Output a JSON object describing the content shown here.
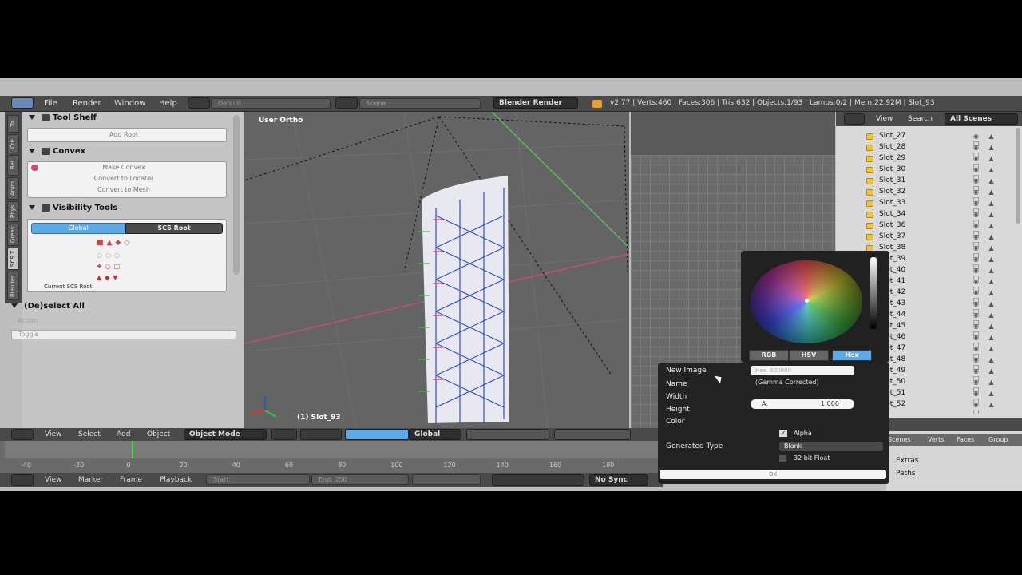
{
  "topbar": {
    "menus": [
      "File",
      "Render",
      "Window",
      "Help"
    ],
    "screen_layout": "Default",
    "scene": "Scene",
    "render_engine": "Blender Render",
    "stats": "v2.77 | Verts:460 | Faces:306 | Tris:632 | Objects:1/93 | Lamps:0/2 | Mem:22.92M | Slot_93"
  },
  "left_tabs": [
    "To",
    "Cre",
    "Rel",
    "Anim",
    "Phys",
    "Greas",
    "SCS T",
    "Blender"
  ],
  "toolshelf": {
    "title": "Tool Shelf",
    "add_root": "Add Root",
    "convex_title": "Convex",
    "convex_buttons": [
      "Make Convex",
      "Convert to Locator",
      "Convert to Mesh"
    ],
    "visibility_title": "Visibility Tools",
    "tab_global": "Global",
    "tab_scs_root": "SCS Root",
    "current_root": "Current SCS Root:",
    "deselect_title": "(De)select All",
    "action_label": "Action",
    "action_value": "Toggle"
  },
  "viewport": {
    "view_name": "User Ortho",
    "object_name": "(1) Slot_93"
  },
  "outliner": {
    "menus": [
      "View",
      "Search"
    ],
    "scope": "All Scenes",
    "items": [
      "Slot_27",
      "Slot_28",
      "Slot_29",
      "Slot_30",
      "Slot_31",
      "Slot_32",
      "Slot_33",
      "Slot_34",
      "Slot_36",
      "Slot_37",
      "Slot_38",
      "Slot_39",
      "Slot_40",
      "Slot_41",
      "Slot_42",
      "Slot_43",
      "Slot_44",
      "Slot_45",
      "Slot_46",
      "Slot_47",
      "Slot_48",
      "Slot_49",
      "Slot_50",
      "Slot_51",
      "Slot_52"
    ]
  },
  "view3d_header": {
    "menus": [
      "View",
      "Select",
      "Add",
      "Object"
    ],
    "mode": "Object Mode",
    "orientation": "Global"
  },
  "timeline": {
    "ticks": [
      "-40",
      "-20",
      "0",
      "20",
      "40",
      "60",
      "80",
      "100",
      "120",
      "140",
      "160",
      "180"
    ],
    "menus": [
      "View",
      "Marker",
      "Frame",
      "Playback"
    ],
    "start_label": "Start:",
    "end_label": "End:",
    "end_value": "250",
    "sync": "No Sync"
  },
  "new_image_popup": {
    "title": "New Image",
    "labels": [
      "Name",
      "Width",
      "Height",
      "Color"
    ],
    "hex_field": "Hex: 000000",
    "gamma_note": "(Gamma Corrected)",
    "alpha_label": "A:",
    "alpha_value": "1.000",
    "alpha_checkbox": "Alpha",
    "generated_type_label": "Generated Type",
    "generated_type_value": "Blank",
    "float_label": "32 bit Float",
    "ok_label": "OK"
  },
  "color_picker": {
    "tabs": [
      "RGB",
      "HSV",
      "Hex"
    ],
    "active_tab": "Hex"
  },
  "right_props": {
    "tabs": [
      "Scenes",
      "Verts",
      "Faces",
      "Group"
    ],
    "rows": [
      "Extras",
      "Paths"
    ]
  },
  "colors": {
    "header_bg": "#4a4a4a",
    "panel_bg": "#c5c5c5",
    "active_blue": "#5ea9e8",
    "viewport_bg": "#646464",
    "popup_bg": "#232323"
  }
}
